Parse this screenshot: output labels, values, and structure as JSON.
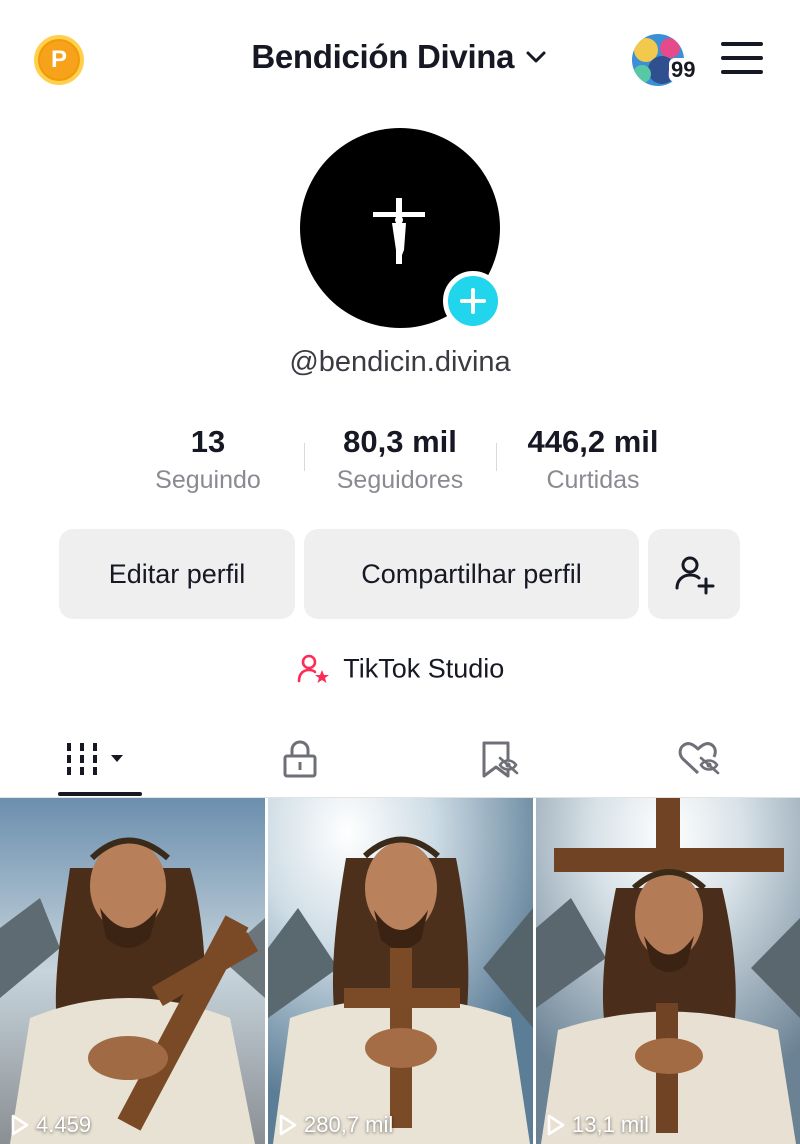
{
  "header": {
    "points_badge": "P",
    "account_name": "Bendición Divina",
    "notification_count": "99"
  },
  "profile": {
    "username": "@bendicin.divina"
  },
  "stats": [
    {
      "value": "13",
      "label": "Seguindo"
    },
    {
      "value": "80,3 mil",
      "label": "Seguidores"
    },
    {
      "value": "446,2 mil",
      "label": "Curtidas"
    }
  ],
  "actions": {
    "edit_profile": "Editar perfil",
    "share_profile": "Compartilhar perfil"
  },
  "studio": {
    "label": "TikTok Studio"
  },
  "tabs": {
    "icons": [
      "videos-grid-icon",
      "lock-icon",
      "bookmark-hidden-icon",
      "liked-hidden-icon"
    ],
    "active_index": 0
  },
  "videos": [
    {
      "views": "4.459"
    },
    {
      "views": "280,7 mil"
    },
    {
      "views": "13,1 mil"
    }
  ],
  "colors": {
    "accent": "#20d5ec",
    "points": "#f7a21b",
    "studio_icon": "#fe2c55",
    "button_bg": "#efeff0"
  }
}
